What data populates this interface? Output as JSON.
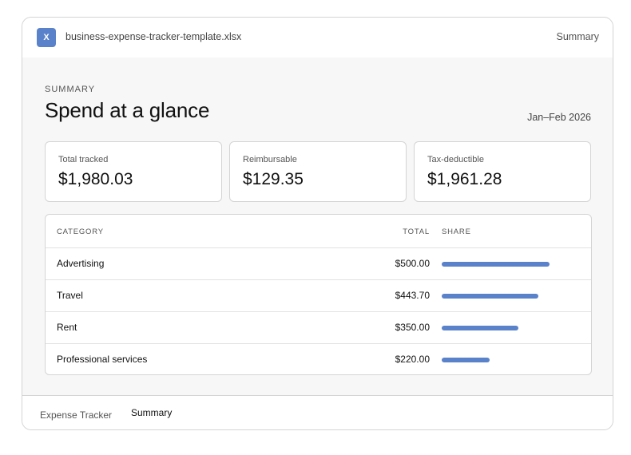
{
  "colors": {
    "accent": "#5a82ca",
    "file_icon_bg": "#5a82ca"
  },
  "titlebar": {
    "file_icon_glyph": "X",
    "file_icon_name": "excel-file-icon",
    "filename": "business-expense-tracker-template.xlsx",
    "right_label": "Summary"
  },
  "summary": {
    "eyebrow": "SUMMARY",
    "title": "Spend at a glance",
    "date_range": "Jan–Feb 2026"
  },
  "cards": [
    {
      "label": "Total tracked",
      "value": "$1,980.03"
    },
    {
      "label": "Reimbursable",
      "value": "$129.35"
    },
    {
      "label": "Tax-deductible",
      "value": "$1,961.28"
    }
  ],
  "table": {
    "headers": {
      "category": "CATEGORY",
      "total": "TOTAL",
      "share": "SHARE"
    },
    "rows": [
      {
        "category": "Advertising",
        "total": "$500.00",
        "share": 0.25
      },
      {
        "category": "Travel",
        "total": "$443.70",
        "share": 0.224
      },
      {
        "category": "Rent",
        "total": "$350.00",
        "share": 0.177
      },
      {
        "category": "Professional services",
        "total": "$220.00",
        "share": 0.111
      }
    ]
  },
  "tabs": [
    {
      "label": "Expense Tracker",
      "active": false
    },
    {
      "label": "Summary",
      "active": true
    }
  ]
}
